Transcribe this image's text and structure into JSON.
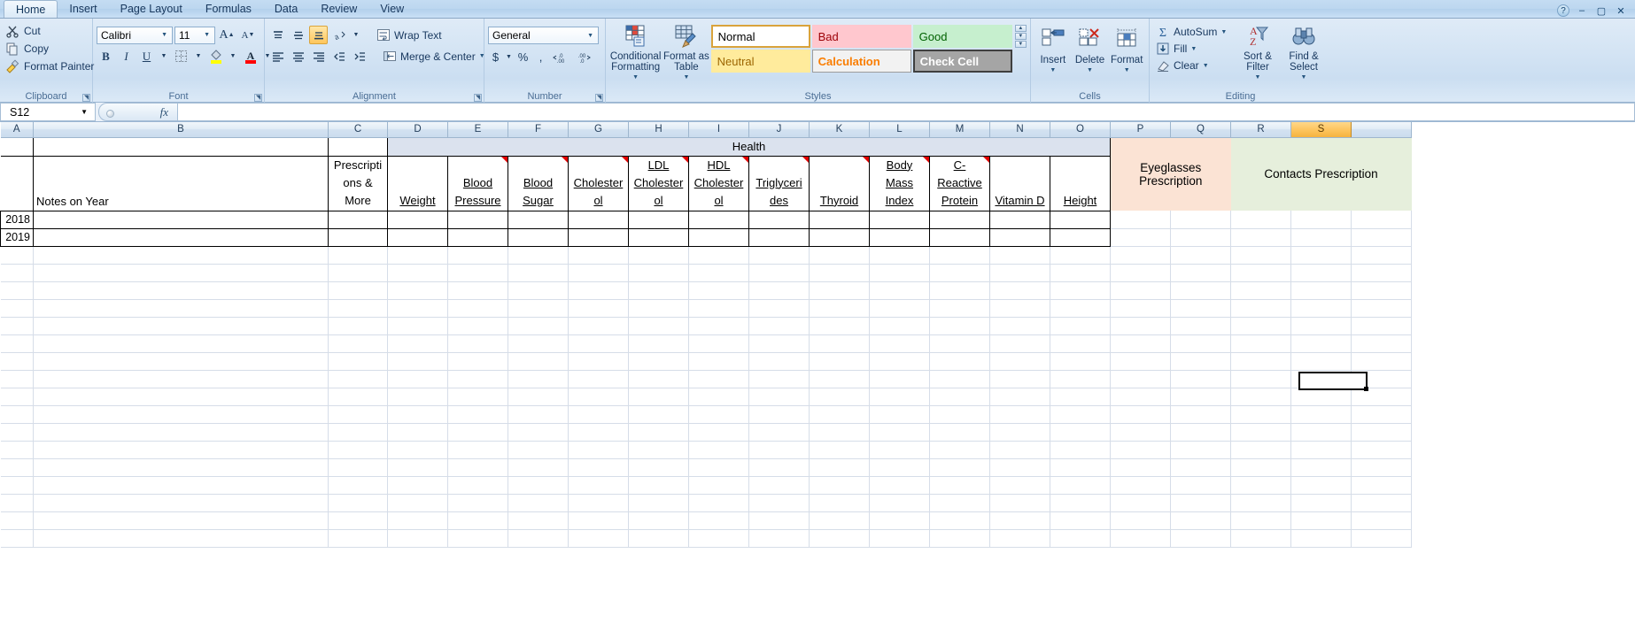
{
  "window": {
    "minimize": "–",
    "maximize": "▢",
    "close": "✕",
    "help": "?"
  },
  "ribbon": {
    "tabs": [
      {
        "label": "Home",
        "active": true
      },
      {
        "label": "Insert",
        "active": false
      },
      {
        "label": "Page Layout",
        "active": false
      },
      {
        "label": "Formulas",
        "active": false
      },
      {
        "label": "Data",
        "active": false
      },
      {
        "label": "Review",
        "active": false
      },
      {
        "label": "View",
        "active": false
      }
    ],
    "clipboard": {
      "label": "Clipboard",
      "items": [
        {
          "label": "Cut",
          "icon": "scissors-icon"
        },
        {
          "label": "Copy",
          "icon": "copy-icon"
        },
        {
          "label": "Format Painter",
          "icon": "paintbrush-icon"
        }
      ]
    },
    "font": {
      "label": "Font",
      "family": "Calibri",
      "size": "11",
      "grow": "A",
      "shrink": "A",
      "bold": "B",
      "italic": "I",
      "underline": "U",
      "borders_icon": "borders-icon",
      "fill_icon": "fill-color-icon",
      "fontcolor_icon": "font-color-icon"
    },
    "alignment": {
      "label": "Alignment",
      "wrap_text": "Wrap Text",
      "merge_center": "Merge & Center",
      "top_align": "top-align-icon",
      "middle_align": "middle-align-icon",
      "bottom_align": "bottom-align-icon",
      "orientation": "orientation-icon",
      "align_left": "align-left-icon",
      "align_center": "align-center-icon",
      "align_right": "align-right-icon",
      "decrease_indent": "decrease-indent-icon",
      "increase_indent": "increase-indent-icon"
    },
    "number": {
      "label": "Number",
      "format": "General",
      "currency": "$",
      "percent": "%",
      "comma": ",",
      "increase_decimal": ".00",
      "decrease_decimal": ".0"
    },
    "styles": {
      "label": "Styles",
      "conditional_formatting": "Conditional Formatting",
      "format_as_table": "Format as Table",
      "gallery": [
        {
          "label": "Normal",
          "kind": "normal"
        },
        {
          "label": "Bad",
          "kind": "bad"
        },
        {
          "label": "Good",
          "kind": "good"
        },
        {
          "label": "Neutral",
          "kind": "neutral"
        },
        {
          "label": "Calculation",
          "kind": "calc"
        },
        {
          "label": "Check Cell",
          "kind": "check"
        }
      ],
      "scroll_up": "▲",
      "scroll_down": "▼",
      "scroll_more": "▼"
    },
    "cells": {
      "label": "Cells",
      "items": [
        {
          "label": "Insert",
          "icon": "insert-cells-icon"
        },
        {
          "label": "Delete",
          "icon": "delete-cells-icon"
        },
        {
          "label": "Format",
          "icon": "format-cells-icon"
        }
      ]
    },
    "editing": {
      "label": "Editing",
      "items": [
        {
          "label": "AutoSum",
          "icon": "autosum-icon"
        },
        {
          "label": "Fill",
          "icon": "fill-icon"
        },
        {
          "label": "Clear",
          "icon": "clear-icon"
        }
      ],
      "sort_filter": "Sort & Filter",
      "find_select": "Find & Select"
    }
  },
  "formula_bar": {
    "name_box": "S12",
    "formula": "",
    "fx": "fx"
  },
  "sheet": {
    "columns": [
      "A",
      "B",
      "C",
      "D",
      "E",
      "F",
      "G",
      "H",
      "I",
      "J",
      "K",
      "L",
      "M",
      "N",
      "O",
      "P",
      "Q",
      "R",
      "S"
    ],
    "selected_column": "S",
    "selected_cell": "S12",
    "band": {
      "health": "Health",
      "eyeglasses": "Eyeglasses Prescription",
      "contacts": "Contacts Prescription"
    },
    "headers": {
      "b": "Notes on Year",
      "c": [
        "Prescripti",
        "ons &",
        "More"
      ],
      "d": [
        "Weight"
      ],
      "e": [
        "Blood",
        "Pressure"
      ],
      "f": [
        "Blood",
        "Sugar"
      ],
      "g": [
        "Cholester",
        "ol"
      ],
      "h": [
        "LDL",
        "Cholester",
        "ol"
      ],
      "i": [
        "HDL",
        "Cholester",
        "ol"
      ],
      "j": [
        "Triglyceri",
        "des"
      ],
      "k": [
        "Thyroid"
      ],
      "l": [
        "Body",
        "Mass",
        "Index"
      ],
      "m": [
        "C-",
        "Reactive",
        "Protein"
      ],
      "n": [
        "Vitamin D"
      ],
      "o": [
        "Height"
      ]
    },
    "rows": [
      {
        "year": "2018"
      },
      {
        "year": "2019"
      }
    ]
  },
  "colors": {
    "selected_header": "#f5b33f",
    "eyeglasses_fill": "#fbe3d4",
    "contacts_fill": "#e6efdc",
    "band_fill": "#dbe2ee",
    "comment_marker": "#e00000"
  }
}
